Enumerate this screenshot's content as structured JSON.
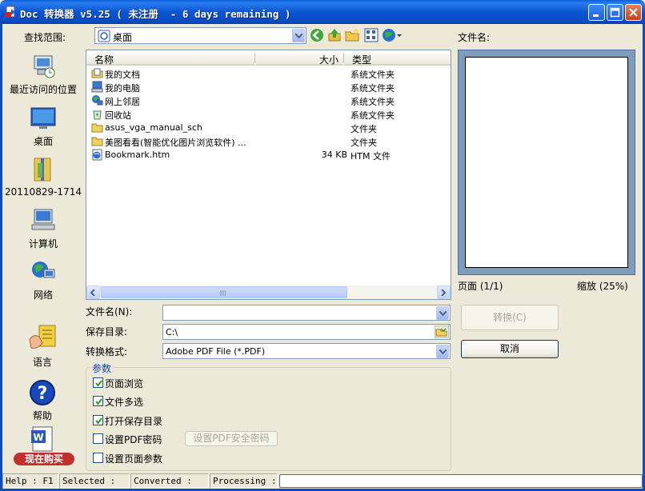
{
  "window": {
    "title": "Doc 转换器 v5.25 ( 未注册  - 6 days remaining )"
  },
  "lookin": {
    "label": "查找范围:",
    "value": "桌面"
  },
  "preview": {
    "filename_label": "文件名:",
    "page": "页面 (1/1)",
    "zoom": "缩放 (25%)"
  },
  "places": [
    {
      "label": "最近访问的位置",
      "icon": "recent-places-icon"
    },
    {
      "label": "桌面",
      "icon": "desktop-icon"
    },
    {
      "label": "20110829-1714",
      "icon": "folder-zip-icon"
    },
    {
      "label": "计算机",
      "icon": "computer-icon"
    },
    {
      "label": "网络",
      "icon": "network-icon"
    },
    {
      "label": "语言",
      "icon": "language-icon"
    },
    {
      "label": "帮助",
      "icon": "help-icon"
    }
  ],
  "filelist": {
    "columns": {
      "name": "名称",
      "size": "大小",
      "type": "类型"
    },
    "rows": [
      {
        "name": "我的文档",
        "size": "",
        "type": "系统文件夹",
        "icon": "my-documents-icon"
      },
      {
        "name": "我的电脑",
        "size": "",
        "type": "系统文件夹",
        "icon": "my-computer-icon"
      },
      {
        "name": "网上邻居",
        "size": "",
        "type": "系统文件夹",
        "icon": "network-places-icon"
      },
      {
        "name": "回收站",
        "size": "",
        "type": "系统文件夹",
        "icon": "recycle-bin-icon"
      },
      {
        "name": "asus_vga_manual_sch",
        "size": "",
        "type": "文件夹",
        "icon": "folder-icon"
      },
      {
        "name": "美图看看(智能优化图片浏览软件) ...",
        "size": "",
        "type": "文件夹",
        "icon": "folder-icon"
      },
      {
        "name": "Bookmark.htm",
        "size": "34 KB",
        "type": "HTM 文件",
        "icon": "html-file-icon"
      }
    ]
  },
  "form": {
    "filename_label": "文件名(N):",
    "filename_value": "",
    "savedir_label": "保存目录:",
    "savedir_value": "C:\\",
    "format_label": "转换格式:",
    "format_value": "Adobe PDF File (*.PDF)"
  },
  "buttons": {
    "convert": "转换(C)",
    "cancel": "取消",
    "pdf_password": "设置PDF安全密码",
    "buy": "现在购买"
  },
  "params": {
    "title": "参数",
    "options": [
      {
        "label": "页面浏览",
        "checked": true
      },
      {
        "label": "文件多选",
        "checked": true
      },
      {
        "label": "打开保存目录",
        "checked": true
      },
      {
        "label": "设置PDF密码",
        "checked": false
      },
      {
        "label": "设置页面参数",
        "checked": false
      }
    ]
  },
  "status": {
    "help": "Help : F1",
    "selected": "Selected :",
    "converted": "Converted :",
    "processing": "Processing :"
  },
  "colors": {
    "titlebar": "#0a4bc8",
    "accent": "#0046d5",
    "buy": "#c0302c"
  }
}
